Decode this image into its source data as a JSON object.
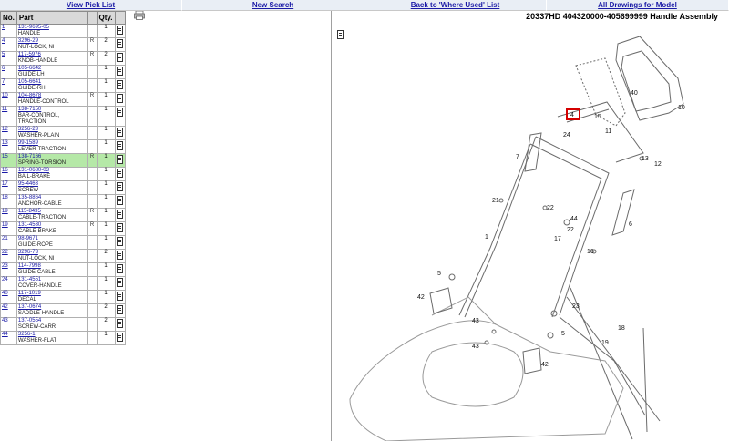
{
  "nav": [
    "View Pick List",
    "New Search",
    "Back to 'Where Used' List",
    "All Drawings for Model"
  ],
  "table": {
    "headers": [
      "No.",
      "Part",
      "Qty."
    ],
    "rows": [
      {
        "no": "1",
        "part": "131-9695-05",
        "desc": "HANDLE",
        "r": "",
        "qty": "1"
      },
      {
        "no": "4",
        "part": "3296-29",
        "desc": "NUT-LOCK, NI",
        "r": "R",
        "qty": "2"
      },
      {
        "no": "5",
        "part": "117-5976",
        "desc": "KNOB-HANDLE",
        "r": "R",
        "qty": "2"
      },
      {
        "no": "6",
        "part": "105-6642",
        "desc": "GUIDE-LH",
        "r": "",
        "qty": "1"
      },
      {
        "no": "7",
        "part": "105-6641",
        "desc": "GUIDE-RH",
        "r": "",
        "qty": "1"
      },
      {
        "no": "10",
        "part": "104-8678",
        "desc": "HANDLE-CONTROL",
        "r": "R",
        "qty": "1"
      },
      {
        "no": "11",
        "part": "138-7150",
        "desc": "BAR-CONTROL, TRACTION",
        "r": "",
        "qty": "1"
      },
      {
        "no": "12",
        "part": "3256-23",
        "desc": "WASHER-PLAIN",
        "r": "",
        "qty": "1"
      },
      {
        "no": "13",
        "part": "99-1589",
        "desc": "LEVER-TRACTION",
        "r": "",
        "qty": "1"
      },
      {
        "no": "15",
        "part": "138-7166",
        "desc": "SPRING-TORSION",
        "r": "R",
        "qty": "1",
        "selected": true
      },
      {
        "no": "16",
        "part": "131-0680-03",
        "desc": "BAIL-BRAKE",
        "r": "",
        "qty": "1"
      },
      {
        "no": "17",
        "part": "95-4463",
        "desc": "SCREW",
        "r": "",
        "qty": "1"
      },
      {
        "no": "18",
        "part": "135-8864",
        "desc": "ANCHOR-CABLE",
        "r": "",
        "qty": "1"
      },
      {
        "no": "19",
        "part": "115-8435",
        "desc": "CABLE-TRACTION",
        "r": "R",
        "qty": "1"
      },
      {
        "no": "19",
        "part": "131-4530",
        "desc": "CABLE-BRAKE",
        "r": "R",
        "qty": "1"
      },
      {
        "no": "21",
        "part": "98-9671",
        "desc": "GUIDE-ROPE",
        "r": "",
        "qty": "1"
      },
      {
        "no": "22",
        "part": "3296-73",
        "desc": "NUT-LOCK, NI",
        "r": "",
        "qty": "2"
      },
      {
        "no": "23",
        "part": "114-7998",
        "desc": "GUIDE-CABLE",
        "r": "",
        "qty": "1"
      },
      {
        "no": "24",
        "part": "131-4551",
        "desc": "COVER-HANDLE",
        "r": "",
        "qty": "1"
      },
      {
        "no": "40",
        "part": "117-1019",
        "desc": "DECAL",
        "r": "",
        "qty": "1"
      },
      {
        "no": "42",
        "part": "137-0674",
        "desc": "SADDLE-HANDLE",
        "r": "",
        "qty": "2"
      },
      {
        "no": "43",
        "part": "137-0554",
        "desc": "SCREW-CARR",
        "r": "",
        "qty": "2"
      },
      {
        "no": "44",
        "part": "3256-1",
        "desc": "WASHER-FLAT",
        "r": "",
        "qty": "1"
      }
    ]
  },
  "drawing": {
    "title": "20337HD   404320000-405699999 Handle Assembly",
    "callouts": [
      "40",
      "10",
      "4",
      "15",
      "11",
      "24",
      "7",
      "13",
      "12",
      "21",
      "22",
      "44",
      "22",
      "17",
      "1",
      "6",
      "16",
      "5",
      "42",
      "23",
      "43",
      "5",
      "43",
      "42",
      "18",
      "19"
    ],
    "highlight": "4",
    "highlight_color": "#d40000"
  }
}
